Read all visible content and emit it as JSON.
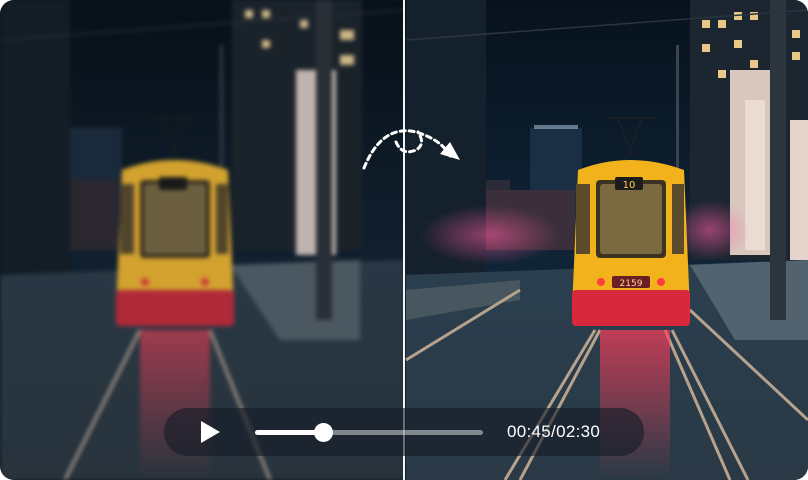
{
  "player": {
    "time_label": "00:45/02:30",
    "progress": 0.3
  },
  "tram": {
    "route_number": "10",
    "fleet_number": "2159"
  },
  "colors": {
    "tram_yellow": "#f2b21c",
    "tram_red": "#d8283c",
    "sky": "#0a1624",
    "divider": "#ffffff"
  },
  "icons": {
    "play": "play-icon",
    "compare": "compare-arrow-icon"
  }
}
